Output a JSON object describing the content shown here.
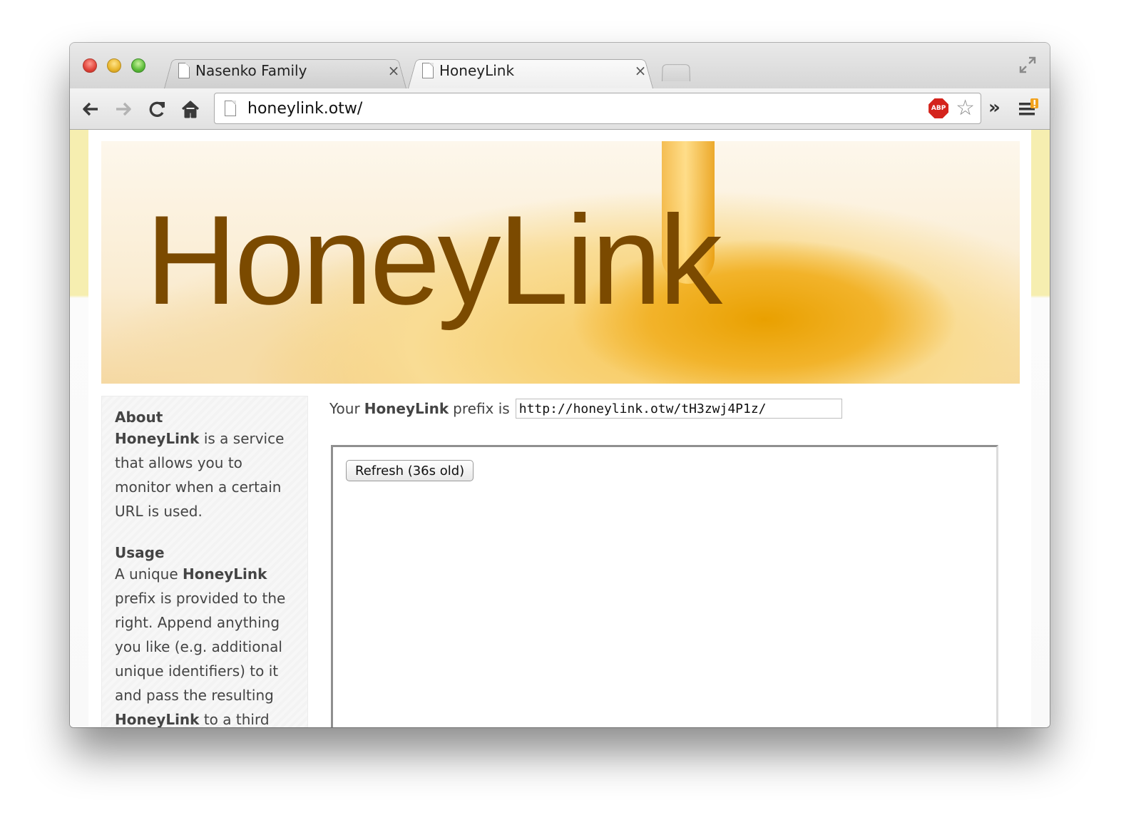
{
  "browser": {
    "tabs": [
      {
        "title": "Nasenko Family",
        "close": "×"
      },
      {
        "title": "HoneyLink",
        "close": "×"
      }
    ],
    "url": "honeylink.otw/",
    "extension_badge": "ABP",
    "overflow_chevron": "»"
  },
  "page": {
    "brand": "HoneyLink",
    "prefix": {
      "label_before": "Your",
      "label_bold": "HoneyLink",
      "label_after": "prefix is",
      "value": "http://honeylink.otw/tH3zwj4P1z/"
    },
    "refresh_button": "Refresh (36s old)",
    "sidebar": {
      "about": {
        "heading": "About",
        "bold": "HoneyLink",
        "text": " is a service that allows you to monitor when a certain URL is used."
      },
      "usage": {
        "heading": "Usage",
        "text_1": "A unique ",
        "bold_1": "HoneyLink",
        "text_2": " prefix is provided to the right. Append anything you like (e.g. additional unique identifiers) to it and pass the resulting ",
        "bold_2": "HoneyLink",
        "text_3": " to a third party. When the"
      }
    }
  }
}
